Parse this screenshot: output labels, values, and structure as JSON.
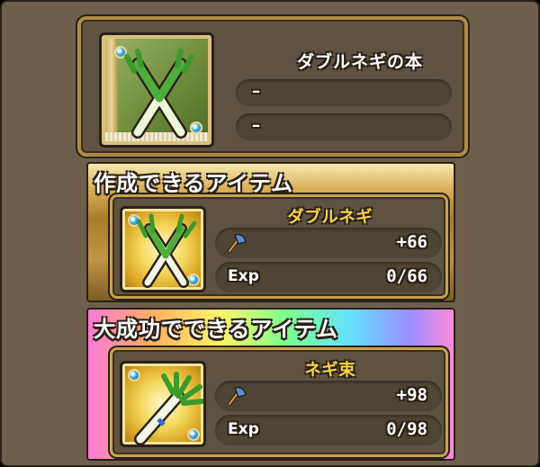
{
  "recipe": {
    "name": "ダブルネギの本",
    "slot1": "–",
    "slot2": "–",
    "icon": "leek-book-icon"
  },
  "normal": {
    "header": "作成できるアイテム",
    "item_name": "ダブルネギ",
    "attack_value": "+66",
    "exp_label": "Exp",
    "exp_value": "0/66",
    "icon": "double-leek-icon"
  },
  "great": {
    "header": "大成功でできるアイテム",
    "item_name": "ネギ束",
    "attack_value": "+98",
    "exp_label": "Exp",
    "exp_value": "0/98",
    "icon": "leek-bundle-icon"
  },
  "colors": {
    "gold_text": "#ffd54a",
    "panel_bg": "#6d5f4c",
    "pill_bg": "#4f4536",
    "frame_gold": "#c9a14e"
  }
}
